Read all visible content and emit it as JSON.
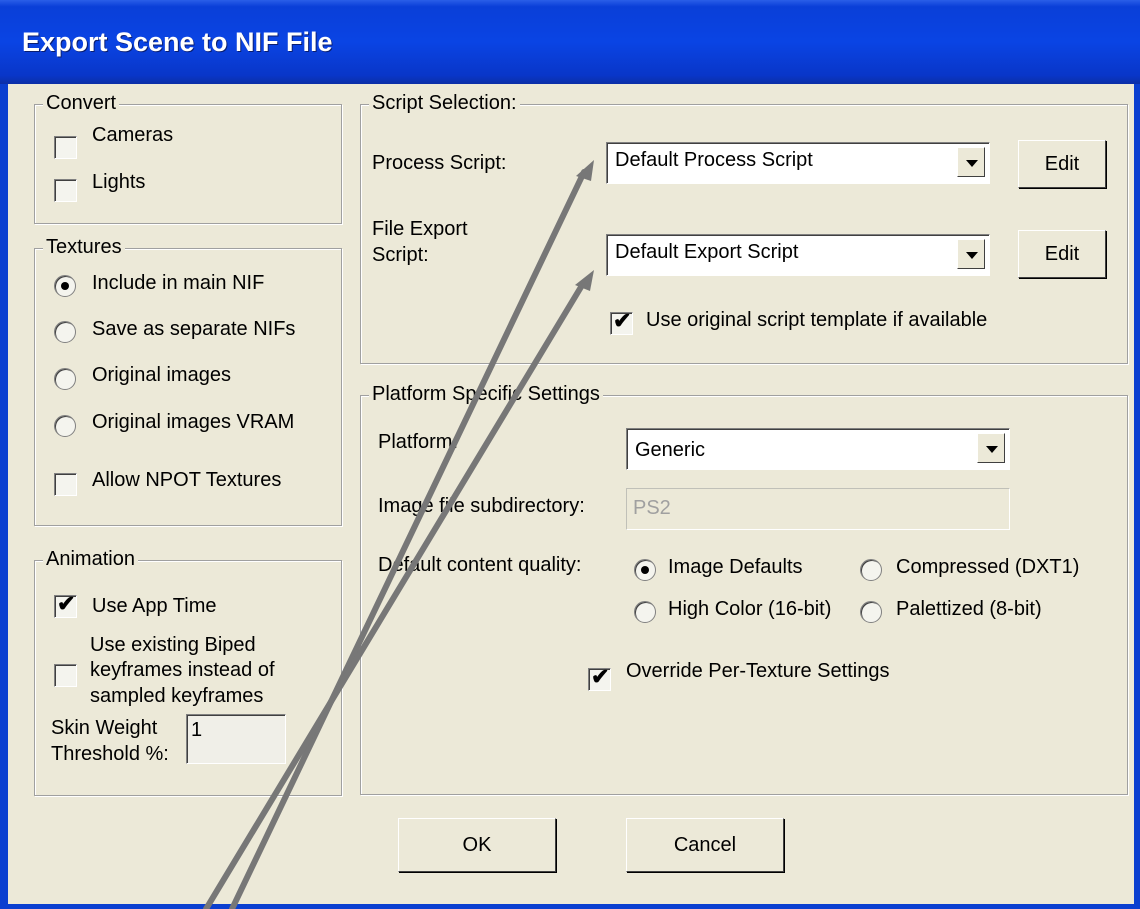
{
  "window": {
    "title": "Export Scene to NIF File"
  },
  "convert": {
    "legend": "Convert",
    "cameras": {
      "label": "Cameras",
      "checked": false
    },
    "lights": {
      "label": "Lights",
      "checked": false
    }
  },
  "textures": {
    "legend": "Textures",
    "options": [
      {
        "label": "Include in main NIF",
        "selected": true
      },
      {
        "label": "Save as separate NIFs",
        "selected": false
      },
      {
        "label": "Original images",
        "selected": false
      },
      {
        "label": "Original images VRAM",
        "selected": false
      }
    ],
    "npot": {
      "label": "Allow NPOT Textures",
      "checked": false
    }
  },
  "animation": {
    "legend": "Animation",
    "app_time": {
      "label": "Use App Time",
      "checked": true
    },
    "biped": {
      "line1": "Use existing Biped",
      "line2": "keyframes instead of",
      "line3": "sampled keyframes",
      "checked": false
    },
    "skin_weight": {
      "line1": "Skin Weight",
      "line2": "Threshold %:",
      "value": "1"
    }
  },
  "script_selection": {
    "legend": "Script Selection:",
    "process_label": "Process Script:",
    "process_value": "Default Process Script",
    "file_export_line1": "File Export",
    "file_export_line2": "Script:",
    "export_value": "Default Export Script",
    "edit_label": "Edit",
    "template": {
      "label": "Use original script template if available",
      "checked": true
    }
  },
  "platform": {
    "legend": "Platform Specific Settings",
    "platform_label": "Platform:",
    "platform_value": "Generic",
    "subdir_label": "Image file subdirectory:",
    "subdir_value": "PS2",
    "quality_label": "Default content quality:",
    "quality_options": [
      {
        "label": "Image Defaults",
        "selected": true
      },
      {
        "label": "Compressed (DXT1)",
        "selected": false
      },
      {
        "label": "High Color (16-bit)",
        "selected": false
      },
      {
        "label": "Palettized (8-bit)",
        "selected": false
      }
    ],
    "override": {
      "label": "Override Per-Texture Settings",
      "checked": true
    }
  },
  "buttons": {
    "ok": "OK",
    "cancel": "Cancel"
  },
  "colors": {
    "title_bar": "#0a44e4",
    "dialog_bg": "#ece9d8",
    "annotation_arrow": "#777777"
  }
}
